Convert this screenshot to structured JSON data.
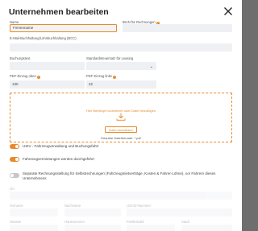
{
  "dialog": {
    "title": "Unternehmen bearbeiten",
    "close_icon": "close-icon"
  },
  "form": {
    "name": {
      "label": "Name",
      "value": "Firmenname"
    },
    "iban": {
      "label": "IBAN für Rechnungen",
      "value": ""
    },
    "email": {
      "label": "E-Mail-Buchhaltung/Lohnbuchhaltung (BCC)",
      "value": ""
    },
    "bookkeeper": {
      "label": "Buchungstext",
      "value": ""
    },
    "leasing": {
      "label": "Standardsteuersatz für Leasing",
      "value": ""
    },
    "pdf_top": {
      "label": "PDF Einzug oben",
      "value": "130"
    },
    "pdf_left": {
      "label": "PDF Einzug links",
      "value": "22"
    }
  },
  "upload": {
    "hint": "Hier Briefkopf hochziehen oder Datei hinzufügen",
    "button_label": "Datei auswählen",
    "allowed_label": "Erlaubte Dateiformate: *.pdf",
    "icon": "upload-icon"
  },
  "toggles": [
    {
      "label": "UStV - Fahrzeugverwaltung und Buchungsfahrt",
      "on": true
    },
    {
      "label": "Fahrzeugvermietungen werden durchgeführt",
      "on": true
    },
    {
      "label": "Separate Rechnungsstellung für Selbstrechnungen (Fahrzeugmietverträge, Kosten & Fahrer-Löhne), vor Fahrern dieses Unternehmens",
      "on": false
    }
  ],
  "faded_fields": {
    "row1": [
      "Ort"
    ],
    "row2": [
      "Vorname",
      "Nachname",
      "USt-ID-Nummer"
    ],
    "row3": [
      "Strasse",
      "Hausnummer",
      "Postleitzahl",
      "Stadt"
    ]
  },
  "colors": {
    "accent": "#e8892b"
  }
}
